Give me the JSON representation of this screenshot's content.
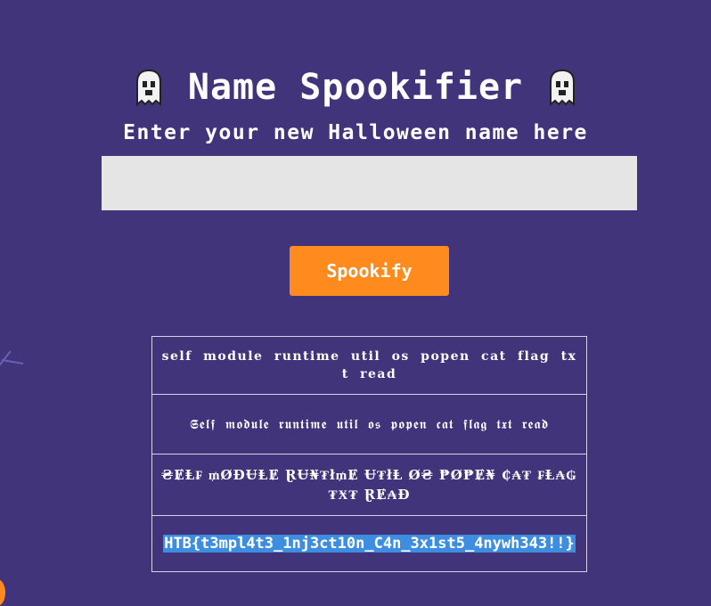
{
  "header": {
    "title": "Name Spookifier",
    "subtitle": "Enter your new Halloween name here"
  },
  "form": {
    "name_value": "",
    "submit_label": "Spookify"
  },
  "results": [
    "self module runtime util os popen cat flag txt read",
    "𝕾𝖊𝖑𝖋 𝖒𝖔𝖉𝖚𝖑𝖊 𝖗𝖚𝖓𝖙𝖎𝖒𝖊 𝖚𝖙𝖎𝖑 𝖔𝖘 𝖕𝖔𝖕𝖊𝖓 𝖈𝖆𝖙 𝖋𝖑𝖆𝖌 𝖙𝖝𝖙 𝖗𝖊𝖆𝖉",
    "₴ɆⱠ₣ ₥ØĐɄⱠɆ ⱤɄ₦₮ł₥Ɇ Ʉ₮łⱠ Ø₴ ₱Ø₱Ɇ₦ ₵₳₮ ₣Ⱡ₳₲ ₮Ӿ₮ ⱤɆ₳Đ",
    "HTB{t3mpl4t3_1nj3ct10n_C4n_3x1st5_4nywh343!!}"
  ],
  "icons": {
    "ghost_left": "ghost-icon",
    "ghost_right": "ghost-icon"
  },
  "colors": {
    "background": "#41347a",
    "accent": "#ff8a1e",
    "input_bg": "#e5e5e5",
    "selection": "#3d8ee0"
  }
}
